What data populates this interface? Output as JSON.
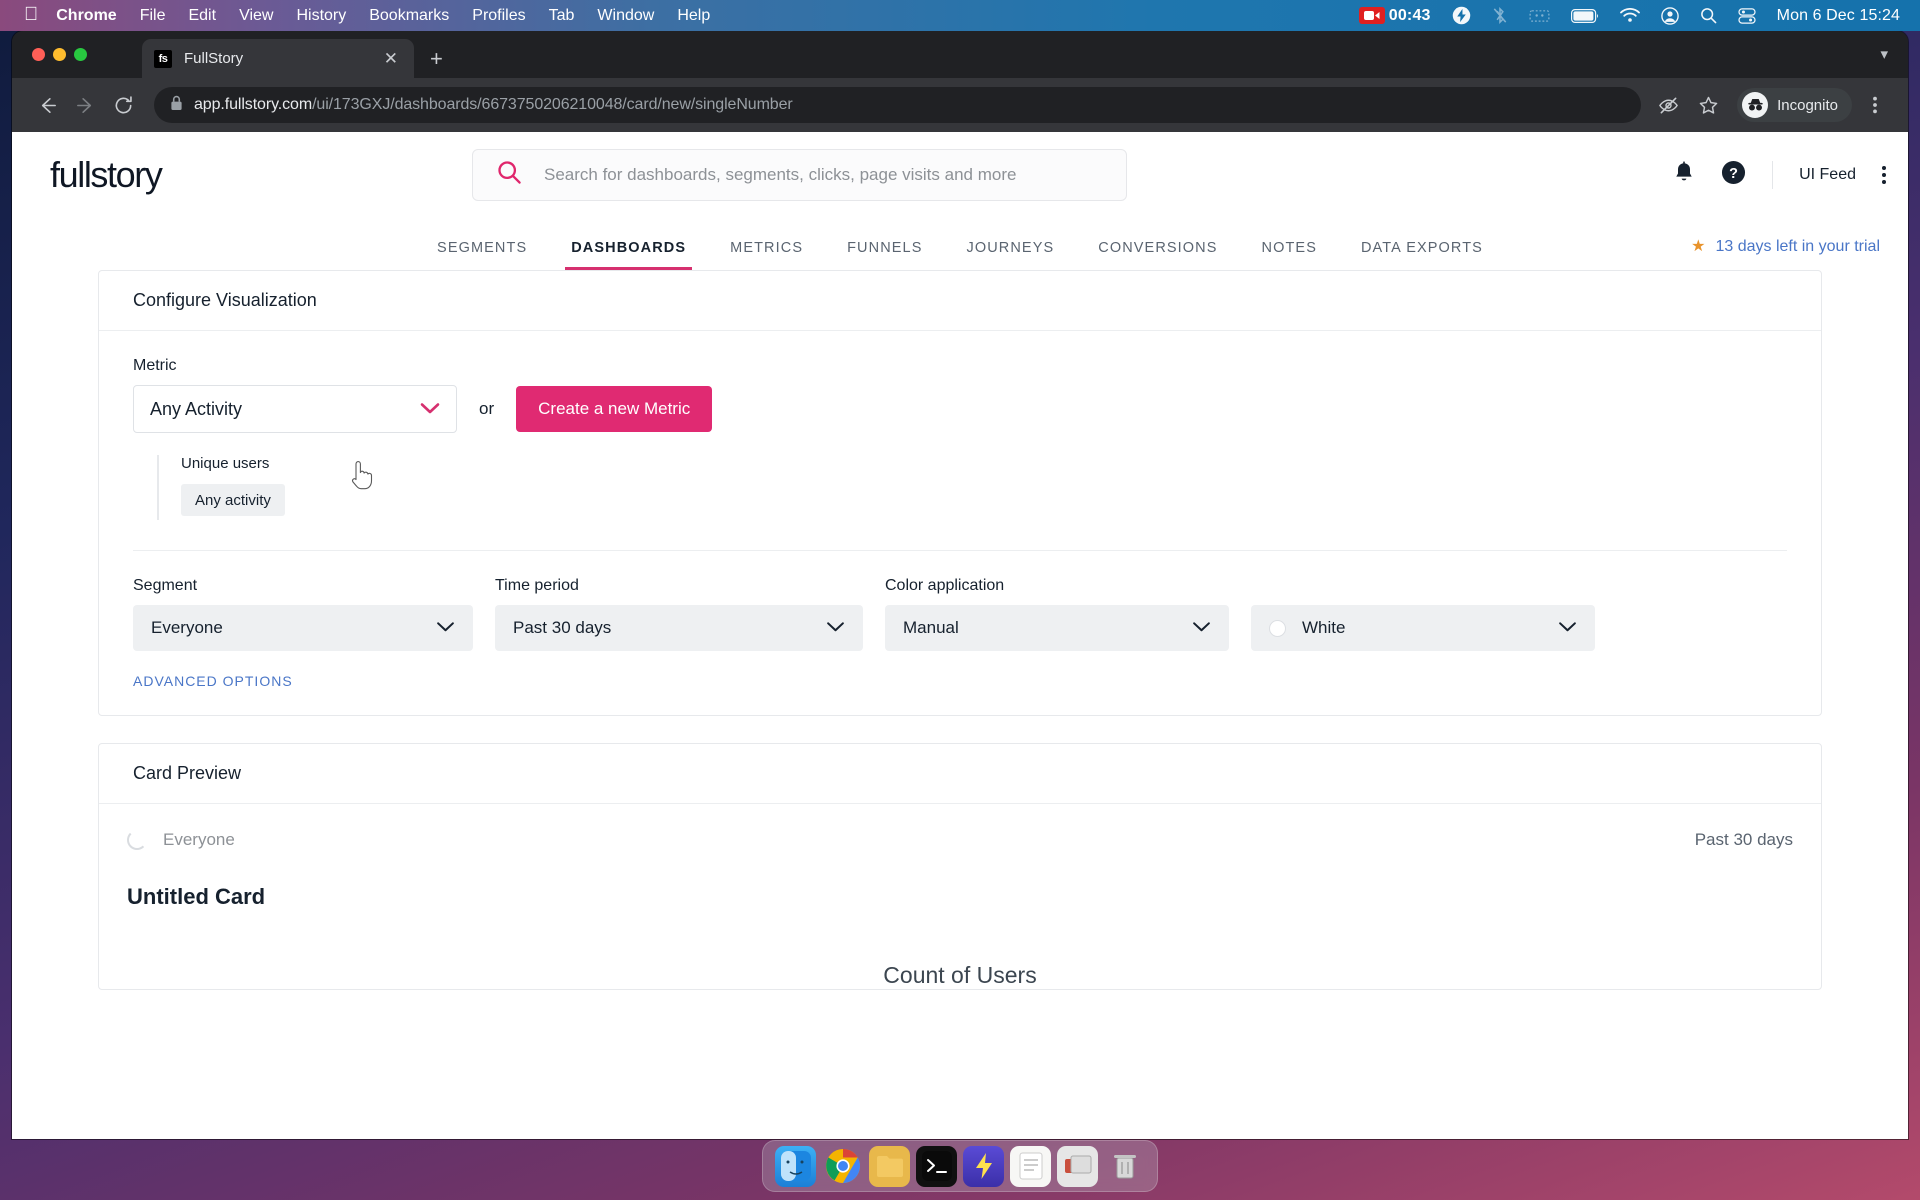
{
  "menubar": {
    "apple_icon": "apple-icon",
    "items": [
      {
        "label": "Chrome",
        "bold": true
      },
      {
        "label": "File",
        "bold": false
      },
      {
        "label": "Edit",
        "bold": false
      },
      {
        "label": "View",
        "bold": false
      },
      {
        "label": "History",
        "bold": false
      },
      {
        "label": "Bookmarks",
        "bold": false
      },
      {
        "label": "Profiles",
        "bold": false
      },
      {
        "label": "Tab",
        "bold": false
      },
      {
        "label": "Window",
        "bold": false
      },
      {
        "label": "Help",
        "bold": false
      }
    ],
    "recording_time": "00:43",
    "status_icons": [
      "screen-record-icon",
      "bolt-icon",
      "bluetooth-off-icon",
      "keyboard-brightness-icon",
      "battery-icon",
      "wifi-icon",
      "account-icon",
      "spotlight-search-icon",
      "control-center-icon"
    ],
    "clock": "Mon 6 Dec  15:24"
  },
  "browser": {
    "tab": {
      "favicon_label": "fs",
      "title": "FullStory",
      "close_icon": "close-icon"
    },
    "new_tab_icon": "plus-icon",
    "window_chevron_icon": "chevron-down-icon",
    "nav": {
      "back_icon": "back-arrow-icon",
      "forward_icon": "forward-arrow-icon",
      "reload_icon": "reload-icon"
    },
    "omnibox": {
      "lock_icon": "lock-icon",
      "url_host": "app.fullstory.com",
      "url_path": "/ui/173GXJ/dashboards/6673750206210048/card/new/singleNumber"
    },
    "toolbar_icons": [
      "eye-slash-icon",
      "star-icon"
    ],
    "incognito_label": "Incognito",
    "menu_icon": "kebab-menu-icon"
  },
  "app": {
    "logo": "fullstory",
    "search": {
      "icon": "search-icon",
      "placeholder": "Search for dashboards, segments, clicks, page visits and more"
    },
    "header_icons": [
      "bell-icon",
      "help-icon"
    ],
    "account_label": "UI Feed",
    "account_menu_icon": "kebab-menu-icon",
    "nav_tabs": [
      {
        "label": "SEGMENTS",
        "active": false
      },
      {
        "label": "DASHBOARDS",
        "active": true
      },
      {
        "label": "METRICS",
        "active": false
      },
      {
        "label": "FUNNELS",
        "active": false
      },
      {
        "label": "JOURNEYS",
        "active": false
      },
      {
        "label": "CONVERSIONS",
        "active": false
      },
      {
        "label": "NOTES",
        "active": false
      },
      {
        "label": "DATA EXPORTS",
        "active": false
      }
    ],
    "trial": {
      "star_icon": "star-icon",
      "text": "13 days left in your trial"
    }
  },
  "configure_panel": {
    "title": "Configure Visualization",
    "metric": {
      "label": "Metric",
      "selected": "Any Activity",
      "chevron_icon": "chevron-down-icon",
      "or_text": "or",
      "create_button": "Create a new Metric",
      "detail_heading": "Unique users",
      "detail_chip": "Any activity"
    },
    "segment": {
      "label": "Segment",
      "value": "Everyone",
      "chevron_icon": "chevron-down-icon"
    },
    "time_period": {
      "label": "Time period",
      "value": "Past 30 days",
      "chevron_icon": "chevron-down-icon"
    },
    "color_application": {
      "label": "Color application",
      "value": "Manual",
      "chevron_icon": "chevron-down-icon"
    },
    "color_swatch": {
      "value": "White",
      "swatch_hex": "#ffffff",
      "chevron_icon": "chevron-down-icon"
    },
    "advanced_options": "ADVANCED OPTIONS"
  },
  "card_preview": {
    "title": "Card Preview",
    "loading_icon": "spinner-icon",
    "segment_name": "Everyone",
    "time_range": "Past 30 days",
    "card_title": "Untitled Card",
    "metric_caption": "Count of Users"
  },
  "dock": {
    "apps": [
      "finder-icon",
      "chrome-icon",
      "files-icon",
      "terminal-icon",
      "bolt-icon",
      "notes-icon",
      "preview-icon",
      "trash-icon"
    ]
  },
  "colors": {
    "brand_pink": "#e02a72",
    "accent_blue": "#4a76c7",
    "text_dark": "#16212e"
  }
}
